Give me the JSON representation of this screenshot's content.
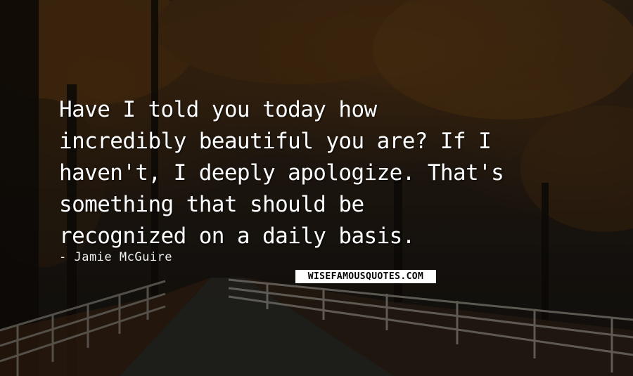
{
  "quote": {
    "lines": [
      "Have I told you today how",
      "incredibly beautiful you are? If I",
      "haven't, I deeply apologize. That's",
      "something that should be",
      "recognized on a daily basis."
    ],
    "author": "- Jamie McGuire"
  },
  "watermark": "WISEFAMOUSQUOTES.COM",
  "colors": {
    "text": "#ffffff",
    "background_dark": "#1b1610",
    "foliage": "#7a4a18",
    "watermark_bg": "#ffffff",
    "watermark_text": "#000000"
  }
}
